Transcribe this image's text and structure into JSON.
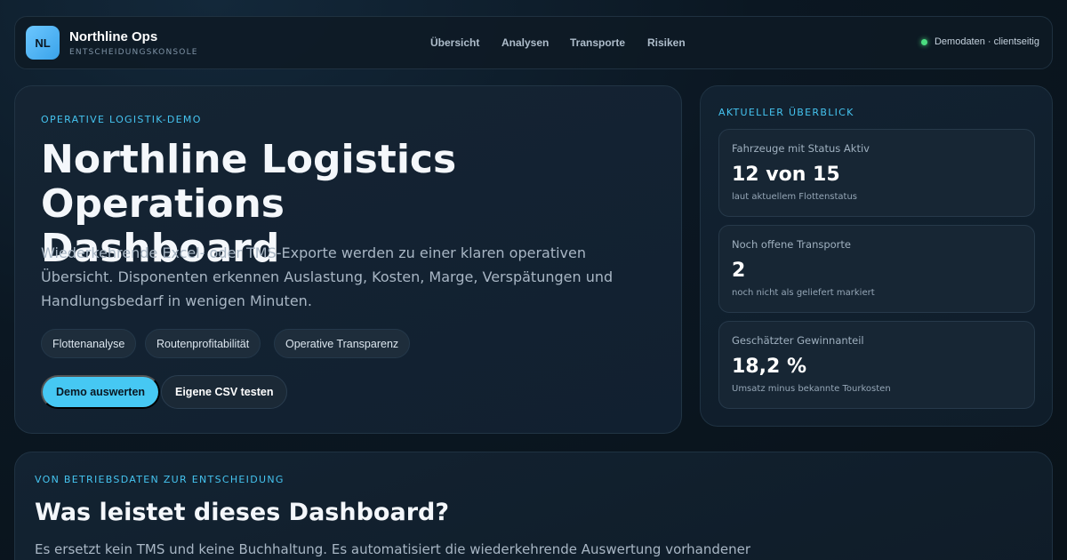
{
  "brand": {
    "logo_initials": "NL",
    "name": "Northline Ops",
    "subtitle": "ENTSCHEIDUNGSKONSOLE"
  },
  "nav": {
    "items": [
      {
        "label": "Übersicht"
      },
      {
        "label": "Analysen"
      },
      {
        "label": "Transporte"
      },
      {
        "label": "Risiken"
      }
    ],
    "status": "Demodaten · clientseitig"
  },
  "hero": {
    "eyebrow": "OPERATIVE LOGISTIK-DEMO",
    "title_line1": "Northline Logistics Operations",
    "title_line2": "Dashboard",
    "description": "Wiederkehrende Excel- oder TMS-Exporte werden zu einer klaren operativen Übersicht. Disponenten erkennen Auslastung, Kosten, Marge, Verspätungen und Handlungsbedarf in wenigen Minuten.",
    "tags": [
      {
        "label": "Flottenanalyse"
      },
      {
        "label": "Routenprofitabilität"
      },
      {
        "label": "Operative Transparenz"
      }
    ],
    "primary_button": "Demo auswerten",
    "secondary_button": "Eigene CSV testen"
  },
  "overview": {
    "eyebrow": "AKTUELLER ÜBERBLICK",
    "stats": [
      {
        "label": "Fahrzeuge mit Status Aktiv",
        "value": "12 von 15",
        "note": "laut aktuellem Flottenstatus"
      },
      {
        "label": "Noch offene Transporte",
        "value": "2",
        "note": "noch nicht als geliefert markiert"
      },
      {
        "label": "Geschätzter Gewinnanteil",
        "value": "18,2 %",
        "note": "Umsatz minus bekannte Tourkosten"
      }
    ]
  },
  "section": {
    "eyebrow": "VON BETRIEBSDATEN ZUR ENTSCHEIDUNG",
    "title": "Was leistet dieses Dashboard?",
    "description": "Es ersetzt kein TMS und keine Buchhaltung. Es automatisiert die wiederkehrende Auswertung vorhandener"
  },
  "colors": {
    "accent": "#46c8f3",
    "status_ok": "#4ade80",
    "background": "#0b1722"
  }
}
